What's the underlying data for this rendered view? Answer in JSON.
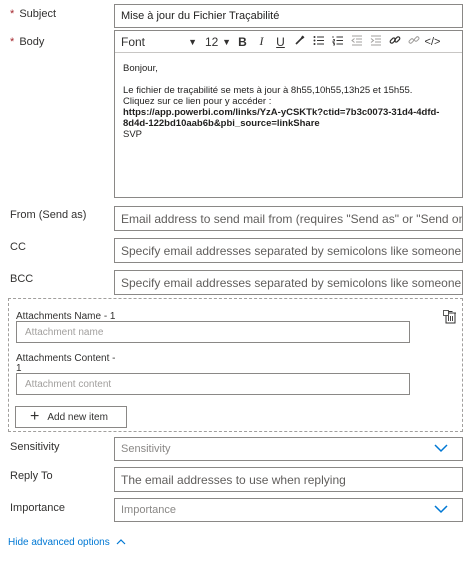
{
  "subject": {
    "label": "Subject",
    "required_mark": "*",
    "value": "Mise à jour du Fichier Traçabilité"
  },
  "body": {
    "label": "Body",
    "required_mark": "*",
    "toolbar": {
      "font": "Font",
      "size": "12",
      "bold": "B",
      "italic": "I",
      "underline": "U",
      "icons": [
        "paint-brush-icon",
        "bullet-list-icon",
        "numbered-list-icon",
        "outdent-icon",
        "indent-icon",
        "link-icon",
        "unlink-icon",
        "code-view-icon"
      ]
    },
    "lines": [
      "Bonjour,",
      "Le fichier de traçabilité se mets à jour à 8h55,10h55,13h25 et 15h55.",
      "Cliquez sur ce lien pour y accéder :",
      "https://app.powerbi.com/links/YzA-yCSKTk?ctid=7b3c0073-31d4-4dfd-",
      "8d4d-122bd10aab6b&pbi_source=linkShare",
      "SVP"
    ]
  },
  "from": {
    "label": "From (Send as)",
    "placeholder": "Email address to send mail from (requires \"Send as\" or \"Send on b"
  },
  "cc": {
    "label": "CC",
    "placeholder": "Specify email addresses separated by semicolons like someone@c"
  },
  "bcc": {
    "label": "BCC",
    "placeholder": "Specify email addresses separated by semicolons like someone@c"
  },
  "attachments": {
    "name_label": "Attachments Name - 1",
    "name_placeholder": "Attachment name",
    "content_label_1": "Attachments Content -",
    "content_label_2": "1",
    "content_placeholder": "Attachment content",
    "add_button": "Add new item"
  },
  "sensitivity": {
    "label": "Sensitivity",
    "placeholder": "Sensitivity"
  },
  "reply_to": {
    "label": "Reply To",
    "placeholder": "The email addresses to use when replying"
  },
  "importance": {
    "label": "Importance",
    "placeholder": "Importance"
  },
  "advanced": {
    "label": "Hide advanced options"
  },
  "colors": {
    "accent": "#0078d4",
    "border": "#8a8886",
    "required": "#a4262c"
  }
}
